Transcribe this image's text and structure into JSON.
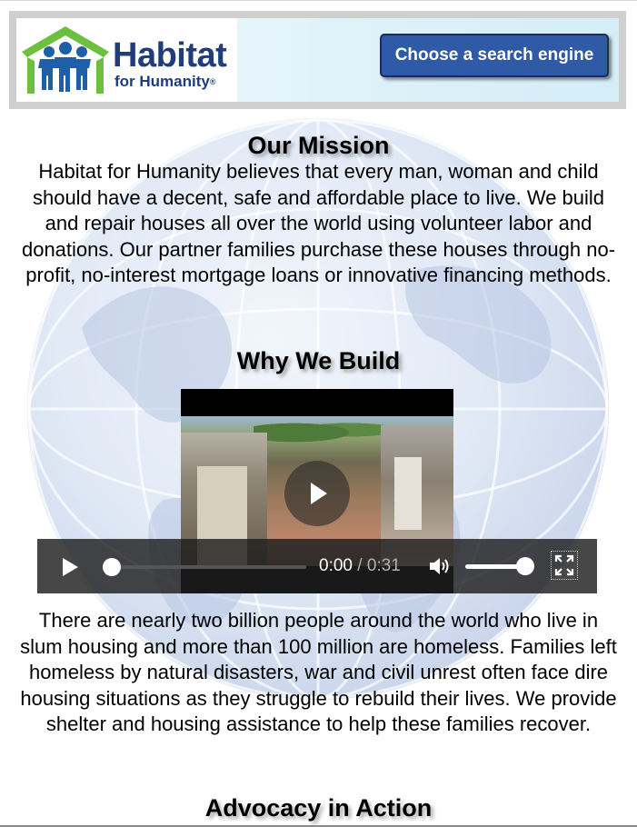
{
  "header": {
    "logo_word1": "Habitat",
    "logo_word2": "for Humanity",
    "logo_registered": "®",
    "search_button_label": "Choose a search engine"
  },
  "mission": {
    "title": "Our Mission",
    "text": "Habitat for Humanity believes that every man, woman and child should have a decent, safe and affordable place to live. We build and repair houses all over the world using volunteer labor and donations. Our partner families purchase these houses through no-profit, no-interest mortgage loans or innovative financing methods."
  },
  "why": {
    "title": "Why We Build",
    "video": {
      "current_time": "0:00",
      "separator": " / ",
      "duration": "0:31",
      "progress": 0,
      "volume": 1.0
    },
    "text": "There are nearly two billion people around the world who live in slum housing and more than 100 million are homeless. Families left homeless by natural disasters, war and civil unrest often face dire housing situations as they struggle to rebuild their lives. We provide shelter and housing assistance to help these families recover."
  },
  "advocacy": {
    "title": "Advocacy in Action"
  },
  "colors": {
    "button_bg": "#2e5aa6",
    "logo_blue": "#1f3d7a",
    "logo_green": "#6cbf3f",
    "video_controls_bg": "#1e1e1e"
  },
  "icons": {
    "play": "play-icon",
    "volume": "volume-icon",
    "fullscreen": "fullscreen-icon",
    "logo_people": "people-house-icon"
  }
}
